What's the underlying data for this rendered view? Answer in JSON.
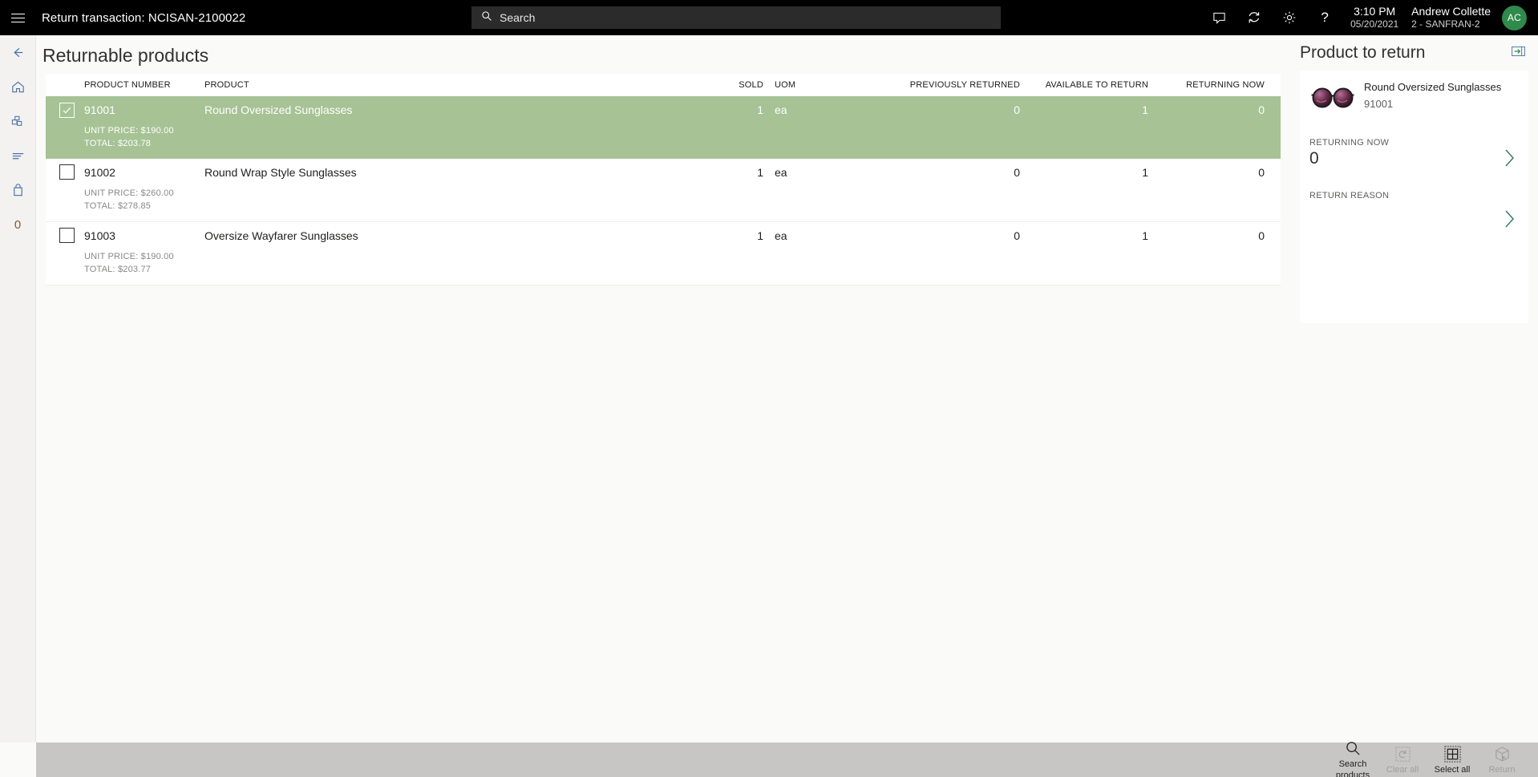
{
  "topbar": {
    "menu_icon": "hamburger-icon",
    "title": "Return transaction: NCISAN-2100022",
    "search": {
      "icon": "search-icon",
      "placeholder": "Search"
    },
    "icons": [
      "message-icon",
      "sync-icon",
      "settings-gear-icon",
      "help-question-icon"
    ],
    "time": "3:10 PM",
    "date": "05/20/2021",
    "user_name": "Andrew Collette",
    "user_store": "2 - SANFRAN-2",
    "avatar_initials": "AC",
    "avatar_color": "#2f8a4b"
  },
  "rail": {
    "items": [
      {
        "icon": "back-arrow-icon",
        "name": "back"
      },
      {
        "icon": "home-icon",
        "name": "home"
      },
      {
        "icon": "products-cubes-icon",
        "name": "products"
      },
      {
        "icon": "list-lines-icon",
        "name": "journal"
      },
      {
        "icon": "shopping-bag-icon",
        "name": "cart"
      }
    ],
    "badge": "0"
  },
  "main": {
    "page_title": "Returnable products",
    "columns": [
      "PRODUCT NUMBER",
      "PRODUCT",
      "SOLD",
      "UOM",
      "PREVIOUSLY RETURNED",
      "AVAILABLE TO RETURN",
      "RETURNING NOW"
    ],
    "selected_row_color": "#a7c295",
    "rows": [
      {
        "selected": true,
        "checked": true,
        "product_number": "91001",
        "product": "Round Oversized Sunglasses",
        "sold": "1",
        "uom": "ea",
        "previously_returned": "0",
        "available_to_return": "1",
        "returning_now": "0",
        "unit_price": "UNIT PRICE: $190.00",
        "total": "TOTAL: $203.78"
      },
      {
        "selected": false,
        "checked": false,
        "product_number": "91002",
        "product": "Round Wrap Style Sunglasses",
        "sold": "1",
        "uom": "ea",
        "previously_returned": "0",
        "available_to_return": "1",
        "returning_now": "0",
        "unit_price": "UNIT PRICE: $260.00",
        "total": "TOTAL: $278.85"
      },
      {
        "selected": false,
        "checked": false,
        "product_number": "91003",
        "product": "Oversize Wayfarer Sunglasses",
        "sold": "1",
        "uom": "ea",
        "previously_returned": "0",
        "available_to_return": "1",
        "returning_now": "0",
        "unit_price": "UNIT PRICE: $190.00",
        "total": "TOTAL: $203.77"
      }
    ]
  },
  "right_panel": {
    "title": "Product to return",
    "expand_icon": "expand-panel-icon",
    "product": {
      "image": "sunglasses-thumbnail",
      "name": "Round Oversized Sunglasses",
      "number": "91001"
    },
    "returning_now": {
      "label": "RETURNING NOW",
      "value": "0",
      "chevron": "chevron-right-icon"
    },
    "return_reason": {
      "label": "RETURN REASON",
      "value": "",
      "chevron": "chevron-right-icon"
    }
  },
  "bottom_bar": {
    "actions": [
      {
        "icon": "search-icon",
        "label": "Search products",
        "disabled": false
      },
      {
        "icon": "clear-all-icon",
        "label": "Clear all",
        "disabled": true
      },
      {
        "icon": "select-all-grid-icon",
        "label": "Select all",
        "disabled": false
      },
      {
        "icon": "return-box-icon",
        "label": "Return",
        "disabled": true
      }
    ]
  }
}
